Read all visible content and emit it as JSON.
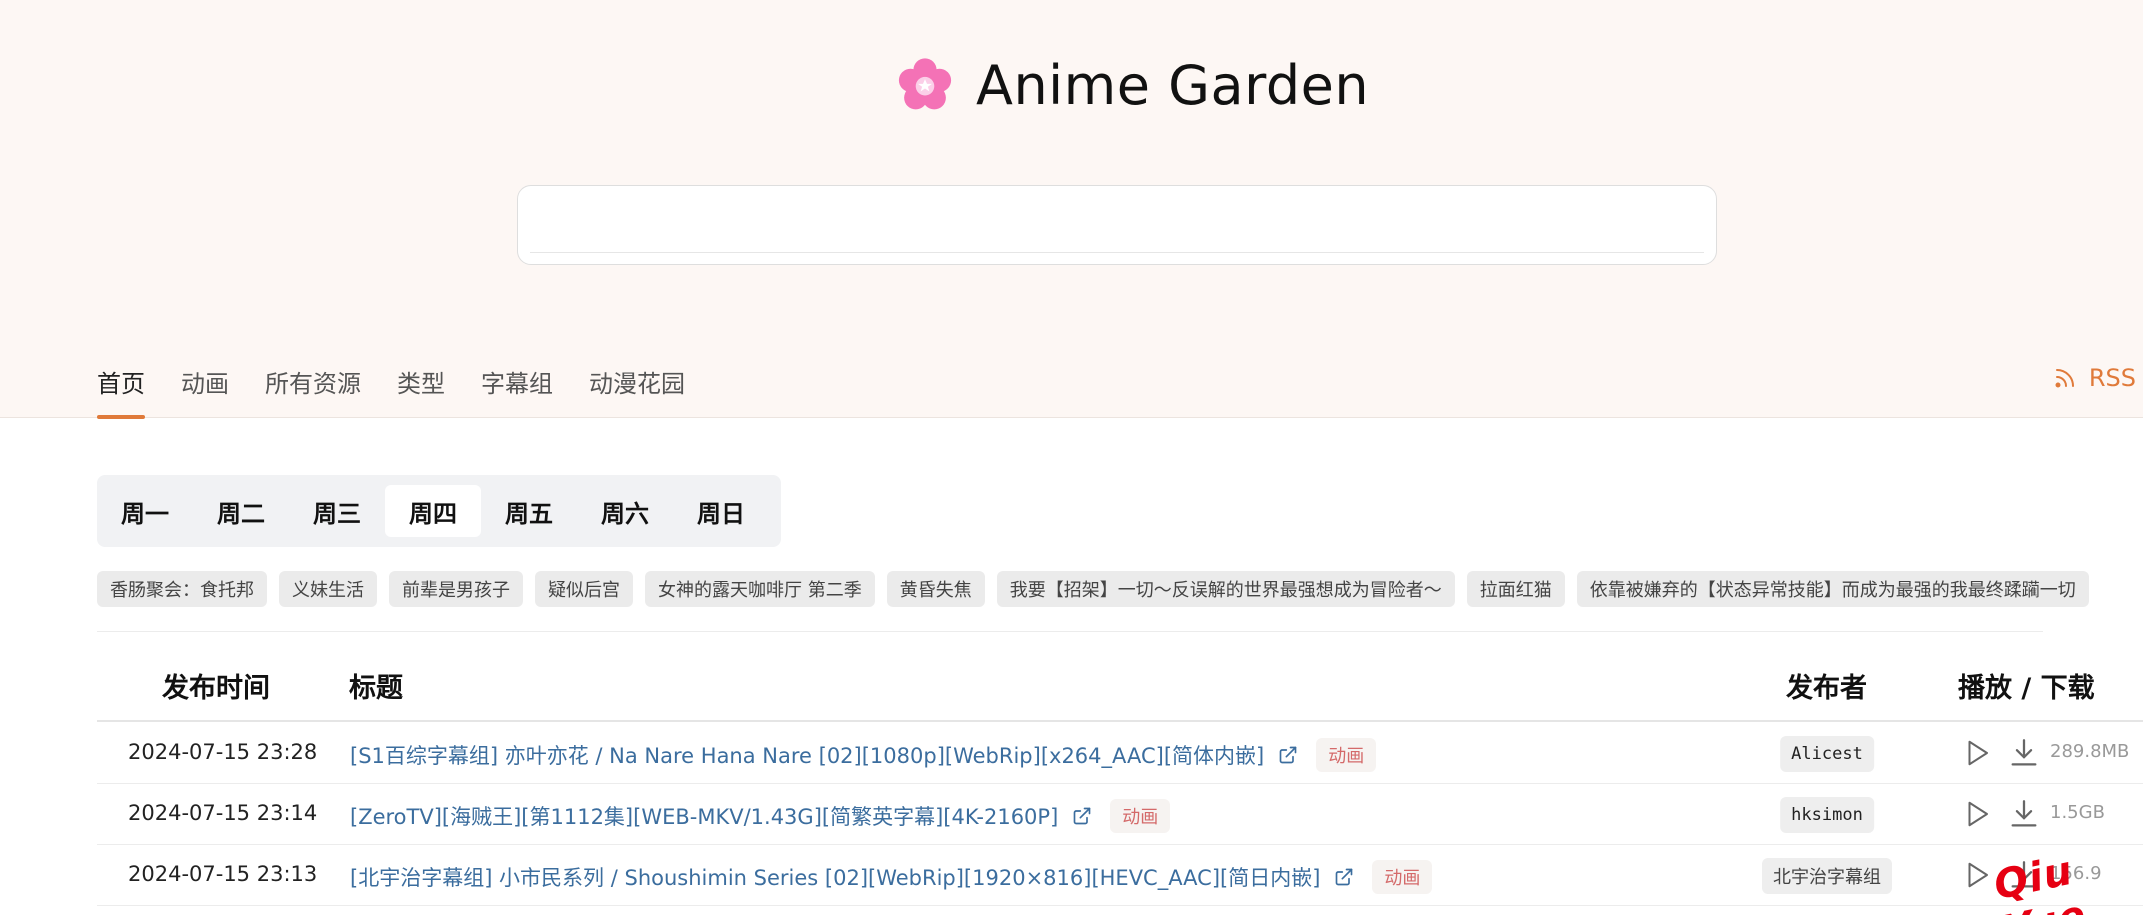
{
  "header": {
    "logo_icon": "sakura-icon",
    "title": "Anime Garden",
    "search": {
      "value": "",
      "placeholder": ""
    }
  },
  "nav": {
    "items": [
      {
        "label": "首页",
        "active": true
      },
      {
        "label": "动画",
        "active": false
      },
      {
        "label": "所有资源",
        "active": false
      },
      {
        "label": "类型",
        "active": false
      },
      {
        "label": "字幕组",
        "active": false
      },
      {
        "label": "动漫花园",
        "active": false
      }
    ],
    "rss_label": "RSS"
  },
  "weekdays": {
    "items": [
      "周一",
      "周二",
      "周三",
      "周四",
      "周五",
      "周六",
      "周日"
    ],
    "selected": "周四"
  },
  "anime_tags": [
    "香肠聚会：食托邦",
    "义妹生活",
    "前辈是男孩子",
    "疑似后宫",
    "女神的露天咖啡厅 第二季",
    "黄昏失焦",
    "我要【招架】一切〜反误解的世界最强想成为冒险者〜",
    "拉面红猫",
    "依靠被嫌弃的【状态异常技能】而成为最强的我最终蹂躏一切"
  ],
  "table": {
    "headers": {
      "time": "发布时间",
      "title": "标题",
      "publisher": "发布者",
      "actions": "播放 / 下载"
    },
    "rows": [
      {
        "time": "2024-07-15 23:28",
        "title": "[S1百综字幕组] 亦叶亦花 / Na Nare Hana Nare [02][1080p][WebRip][x264_AAC][简体内嵌]",
        "type": "动画",
        "publisher": "Alicest",
        "size": "289.8MB"
      },
      {
        "time": "2024-07-15 23:14",
        "title": "[ZeroTV][海贼王][第1112集][WEB-MKV/1.43G][简繁英字幕][4K-2160P]",
        "type": "动画",
        "publisher": "hksimon",
        "size": "1.5GB"
      },
      {
        "time": "2024-07-15 23:13",
        "title": "[北宇治字幕组] 小市民系列 / Shoushimin Series [02][WebRip][1920×816][HEVC_AAC][简日内嵌]",
        "type": "动画",
        "publisher": "北宇治字幕组",
        "size": "156.9"
      }
    ]
  },
  "watermark": "Qiu Yue",
  "colors": {
    "accent": "#e07a3a",
    "link": "#3b6d9e",
    "hero_bg": "#fdf7f4",
    "badge_text": "#d46a6a"
  }
}
